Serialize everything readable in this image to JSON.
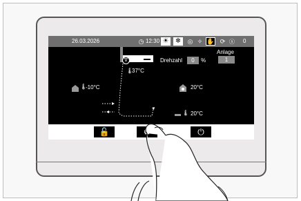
{
  "topbar": {
    "date": "26.03.2026",
    "time": "12:30",
    "counter": "0",
    "icons": [
      "clock-icon",
      "sun-icon",
      "snowflake-icon",
      "circle-icon",
      "fan-icon",
      "hand-icon",
      "cycle-icon"
    ]
  },
  "main": {
    "anlage_label": "Anlage",
    "anlage_value": "1",
    "drehzahl_label": "Drehzahl",
    "drehzahl_value": "0",
    "drehzahl_unit": "%",
    "supply_temp": "37°C",
    "outdoor_temp": "-10°C",
    "room_temp": "20°C",
    "floor_temp": "20°C"
  },
  "bottombar": {
    "icons": [
      "unlock-icon",
      "gear-icon",
      "power-icon"
    ]
  }
}
